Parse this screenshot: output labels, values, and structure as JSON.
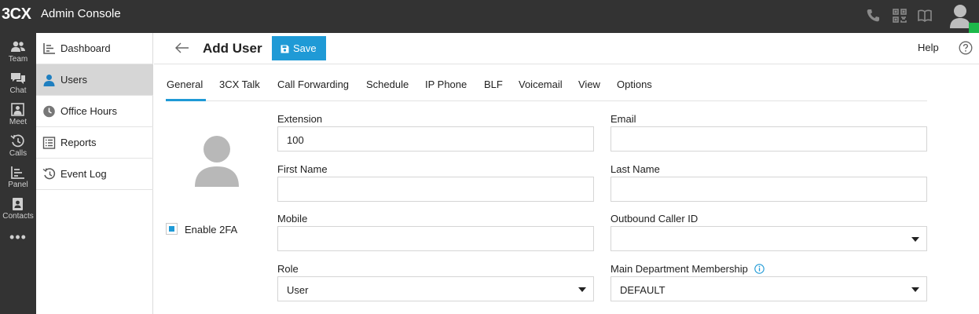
{
  "app": {
    "logo": "3CX",
    "title": "Admin Console"
  },
  "top_icons": [
    "phone-icon",
    "qr-code-icon",
    "book-icon",
    "user-avatar-icon"
  ],
  "rail": {
    "items": [
      {
        "label": "Team",
        "icon": "team-icon"
      },
      {
        "label": "Chat",
        "icon": "chat-icon"
      },
      {
        "label": "Meet",
        "icon": "meet-icon"
      },
      {
        "label": "Calls",
        "icon": "calls-history-icon"
      },
      {
        "label": "Panel",
        "icon": "panel-icon"
      },
      {
        "label": "Contacts",
        "icon": "contacts-icon"
      }
    ],
    "more": "•••"
  },
  "sidebar": {
    "items": [
      {
        "label": "Dashboard",
        "icon": "dashboard-icon",
        "active": false
      },
      {
        "label": "Users",
        "icon": "user-icon",
        "active": true
      },
      {
        "label": "Office Hours",
        "icon": "clock-icon",
        "active": false
      },
      {
        "label": "Reports",
        "icon": "list-icon",
        "active": false
      },
      {
        "label": "Event Log",
        "icon": "history-icon",
        "active": false
      }
    ]
  },
  "header": {
    "title": "Add User",
    "save_label": "Save",
    "help_label": "Help"
  },
  "tabs": [
    {
      "label": "General",
      "active": true
    },
    {
      "label": "3CX Talk",
      "active": false
    },
    {
      "label": "Call Forwarding",
      "active": false
    },
    {
      "label": "Schedule",
      "active": false
    },
    {
      "label": "IP Phone",
      "active": false
    },
    {
      "label": "BLF",
      "active": false
    },
    {
      "label": "Voicemail",
      "active": false
    },
    {
      "label": "View",
      "active": false
    },
    {
      "label": "Options",
      "active": false
    }
  ],
  "twofa": {
    "label": "Enable 2FA",
    "checked": true
  },
  "form": {
    "extension": {
      "label": "Extension",
      "value": "100"
    },
    "email": {
      "label": "Email",
      "value": ""
    },
    "first_name": {
      "label": "First Name",
      "value": ""
    },
    "last_name": {
      "label": "Last Name",
      "value": ""
    },
    "mobile": {
      "label": "Mobile",
      "value": ""
    },
    "outbound_caller_id": {
      "label": "Outbound Caller ID",
      "value": ""
    },
    "role": {
      "label": "Role",
      "value": "User"
    },
    "main_department": {
      "label": "Main Department Membership",
      "value": "DEFAULT"
    }
  },
  "colors": {
    "topbar": "#333333",
    "accent": "#1f9ad6",
    "presence": "#1db84a",
    "active_sidebar": "#d6d6d6"
  }
}
